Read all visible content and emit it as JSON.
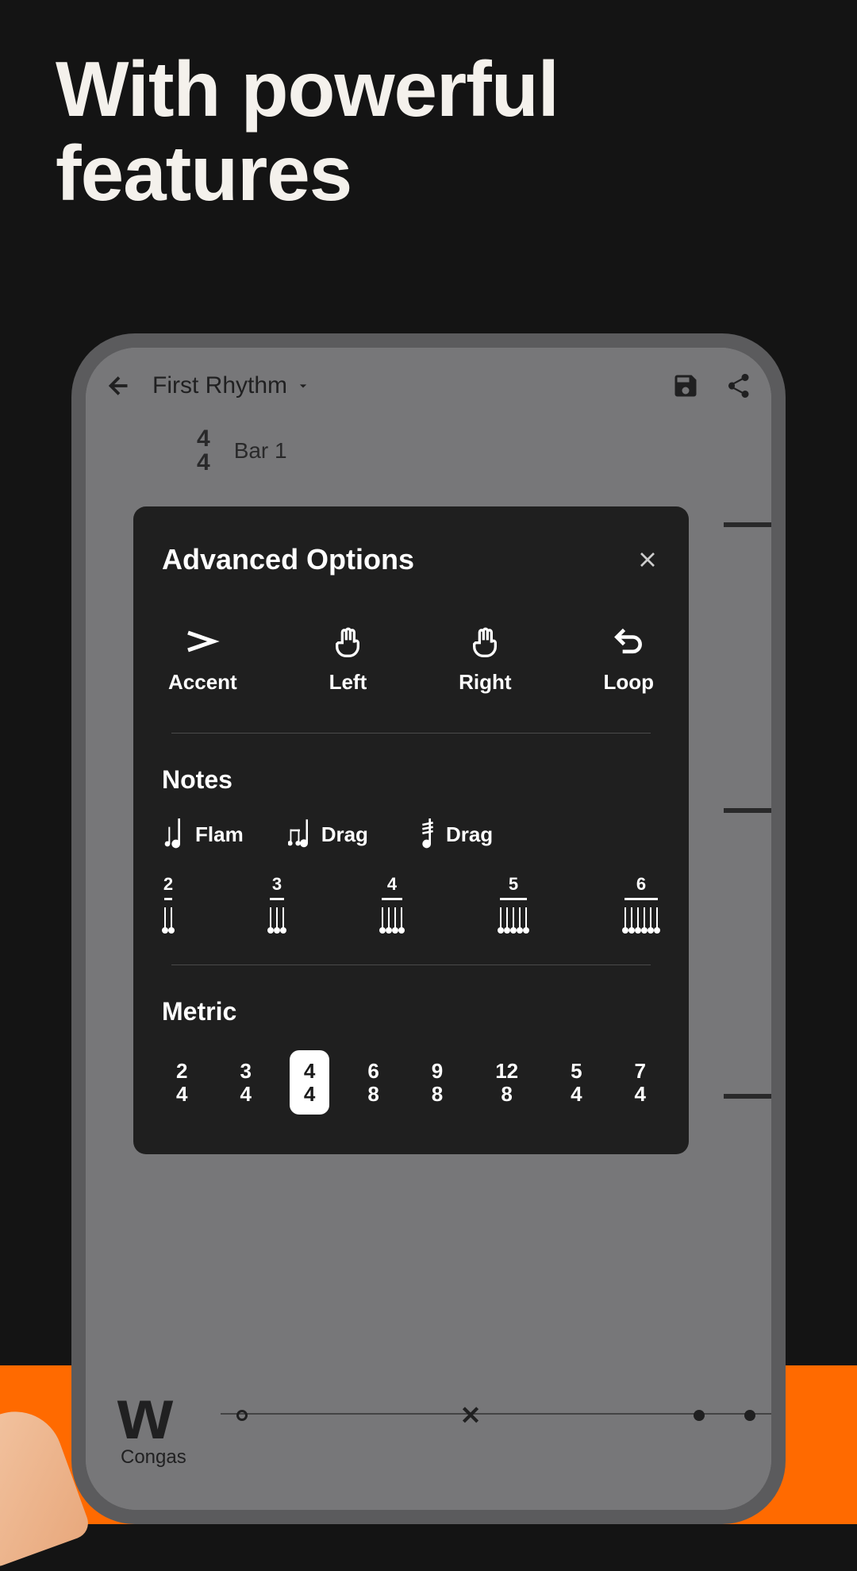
{
  "headline": "With powerful features",
  "app": {
    "title": "First Rhythm",
    "timeSig": {
      "top": "4",
      "bottom": "4"
    },
    "barLabel": "Bar 1",
    "instrument": "Congas"
  },
  "modal": {
    "title": "Advanced Options",
    "actions": [
      {
        "label": "Accent",
        "icon": "accent"
      },
      {
        "label": "Left",
        "icon": "hand"
      },
      {
        "label": "Right",
        "icon": "hand"
      },
      {
        "label": "Loop",
        "icon": "loop"
      }
    ],
    "notesTitle": "Notes",
    "noteItems": [
      {
        "label": "Flam"
      },
      {
        "label": "Drag"
      },
      {
        "label": "Drag"
      }
    ],
    "tuplets": [
      {
        "num": "2",
        "stems": 2
      },
      {
        "num": "3",
        "stems": 3
      },
      {
        "num": "4",
        "stems": 4
      },
      {
        "num": "5",
        "stems": 5
      },
      {
        "num": "6",
        "stems": 6
      }
    ],
    "metricTitle": "Metric",
    "metrics": [
      {
        "top": "2",
        "bottom": "4",
        "selected": false
      },
      {
        "top": "3",
        "bottom": "4",
        "selected": false
      },
      {
        "top": "4",
        "bottom": "4",
        "selected": true
      },
      {
        "top": "6",
        "bottom": "8",
        "selected": false
      },
      {
        "top": "9",
        "bottom": "8",
        "selected": false
      },
      {
        "top": "12",
        "bottom": "8",
        "selected": false
      },
      {
        "top": "5",
        "bottom": "4",
        "selected": false
      },
      {
        "top": "7",
        "bottom": "4",
        "selected": false
      }
    ]
  }
}
